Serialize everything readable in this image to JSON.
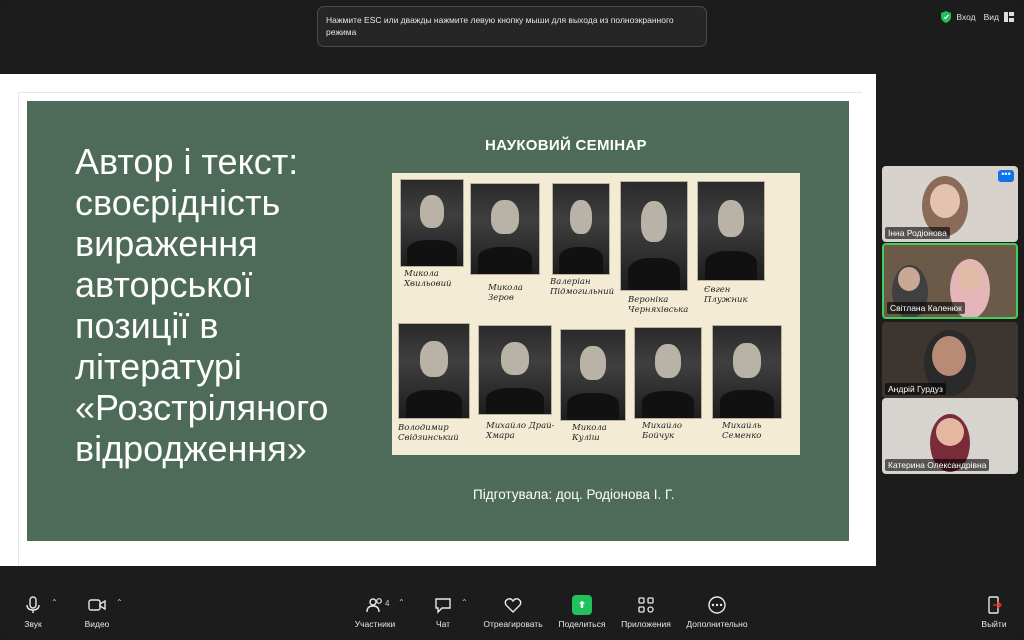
{
  "toast": {
    "text": "Нажмите ESC или дважды нажмите левую кнопку мыши для выхода из полноэкранного режима"
  },
  "topbar": {
    "enter_label": "Вход",
    "view_label": "Вид"
  },
  "slide": {
    "title": "Автор і текст: своєрідність вираження авторської позиції в літературі «Розстріляного відродження»",
    "seminar": "НАУКОВИЙ СЕМІНАР",
    "prepared_by": "Підготувала: доц. Родіонова І. Г.",
    "portraits_top": [
      "Микола Хвильовий",
      "Микола Зеров",
      "Валеріан Підмогильний",
      "Вероніка Черняхівська",
      "Євген Плужник"
    ],
    "portraits_bottom": [
      "Володимир Свідзинський",
      "Михайло Драй-Хмара",
      "Микола Куліш",
      "Михайло Бойчук",
      "Михайль Семенко"
    ]
  },
  "participants": [
    {
      "name": "Інна Родіонова",
      "more": "•••"
    },
    {
      "name": "Світлана Каленюк"
    },
    {
      "name": "Андрій Гурдуз"
    },
    {
      "name": "Катерина Олександрівна"
    }
  ],
  "toolbar": {
    "mute_label": "Звук",
    "video_label": "Видео",
    "participants_label": "Участники",
    "participants_count": "4",
    "chat_label": "Чат",
    "react_label": "Отреагировать",
    "share_label": "Поделиться",
    "apps_label": "Приложения",
    "more_label": "Дополнительно",
    "leave_label": "Выйти"
  },
  "colors": {
    "slide_bg": "#4e6a58",
    "active_border": "#3fcf5a",
    "share_green": "#21c25e",
    "leave_red": "#e02828"
  }
}
